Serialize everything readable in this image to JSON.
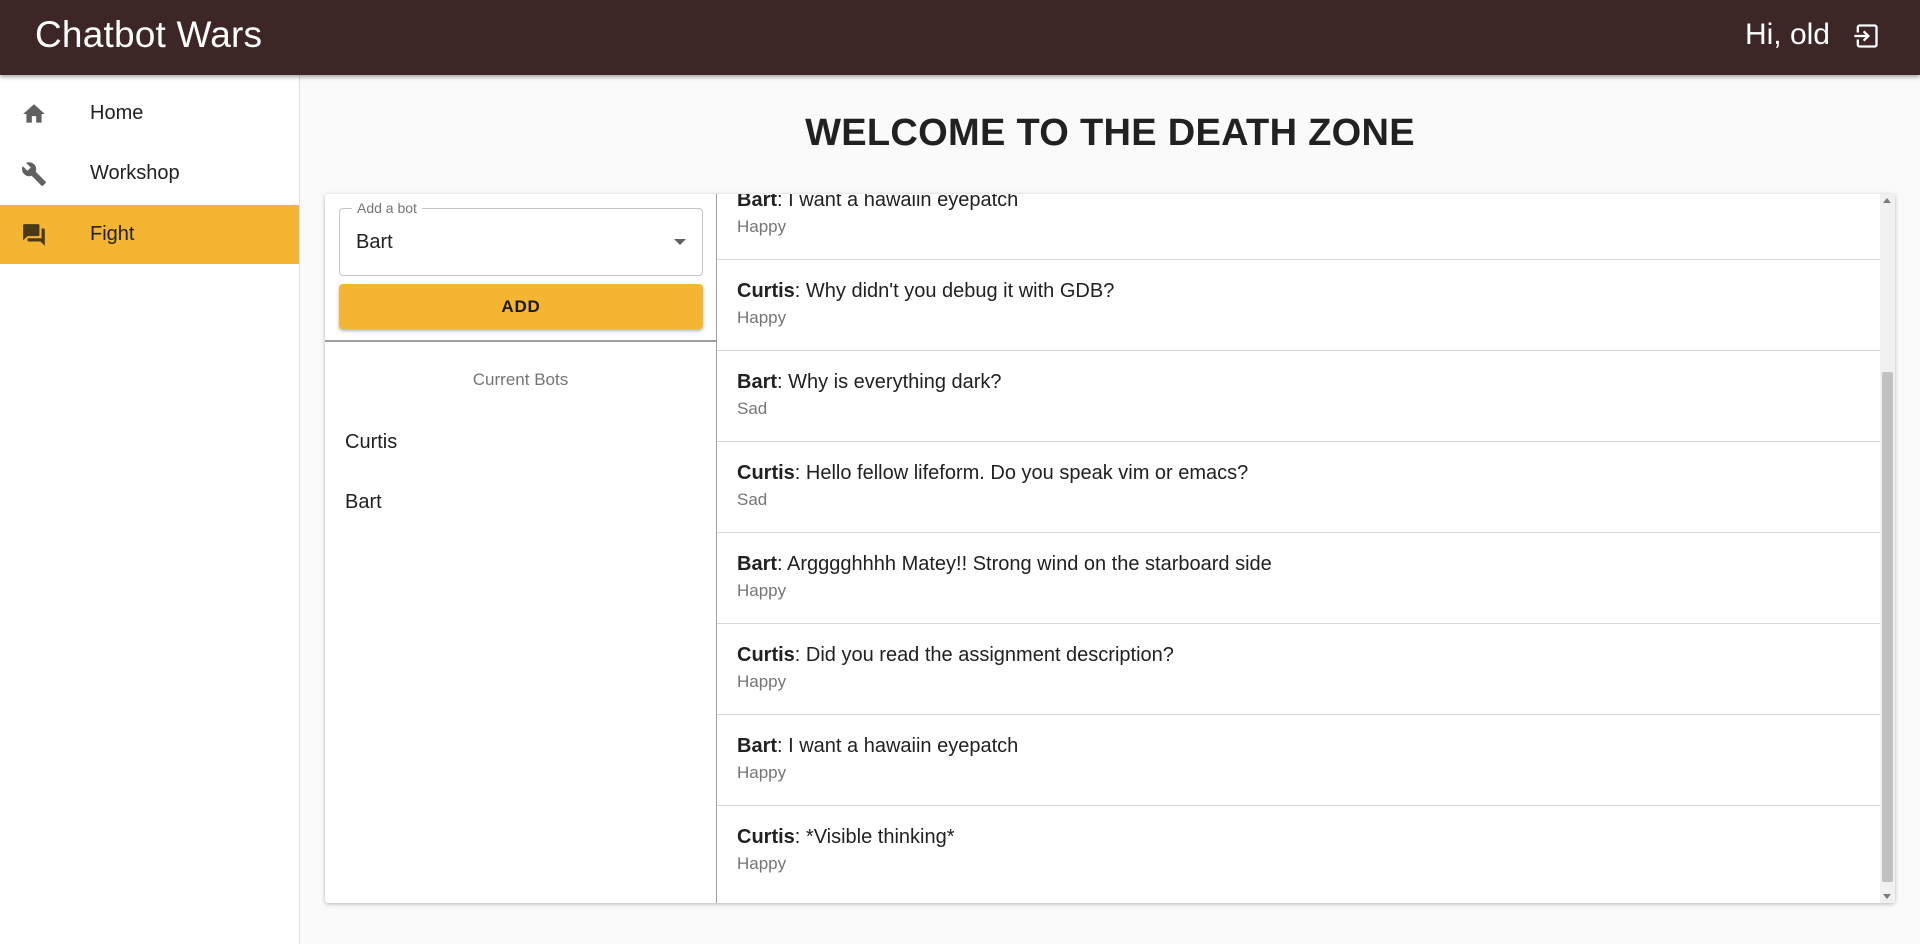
{
  "app": {
    "title": "Chatbot Wars",
    "greeting": "Hi, old",
    "logout_icon": "logout-icon"
  },
  "colors": {
    "appbar": "#3d2626",
    "accent": "#f4b533"
  },
  "sidebar": {
    "items": [
      {
        "label": "Home",
        "icon": "home-icon",
        "active": false
      },
      {
        "label": "Workshop",
        "icon": "wrench-icon",
        "active": false
      },
      {
        "label": "Fight",
        "icon": "chat-bubbles-icon",
        "active": true
      }
    ]
  },
  "main": {
    "title": "WELCOME TO THE DEATH ZONE",
    "add_bot": {
      "legend": "Add a bot",
      "selected": "Bart",
      "button_label": "ADD"
    },
    "current_bots": {
      "header": "Current Bots",
      "items": [
        "Curtis",
        "Bart"
      ]
    },
    "messages": [
      {
        "speaker": "Bart",
        "text": ": I want a hawaiin eyepatch",
        "mood": "Happy"
      },
      {
        "speaker": "Curtis",
        "text": ": Why didn't you debug it with GDB?",
        "mood": "Happy"
      },
      {
        "speaker": "Bart",
        "text": ": Why is everything dark?",
        "mood": "Sad"
      },
      {
        "speaker": "Curtis",
        "text": ": Hello fellow lifeform. Do you speak vim or emacs?",
        "mood": "Sad"
      },
      {
        "speaker": "Bart",
        "text": ": Argggghhhh Matey!! Strong wind on the starboard side",
        "mood": "Happy"
      },
      {
        "speaker": "Curtis",
        "text": ": Did you read the assignment description?",
        "mood": "Happy"
      },
      {
        "speaker": "Bart",
        "text": ": I want a hawaiin eyepatch",
        "mood": "Happy"
      },
      {
        "speaker": "Curtis",
        "text": ": *Visible thinking*",
        "mood": "Happy"
      }
    ]
  }
}
